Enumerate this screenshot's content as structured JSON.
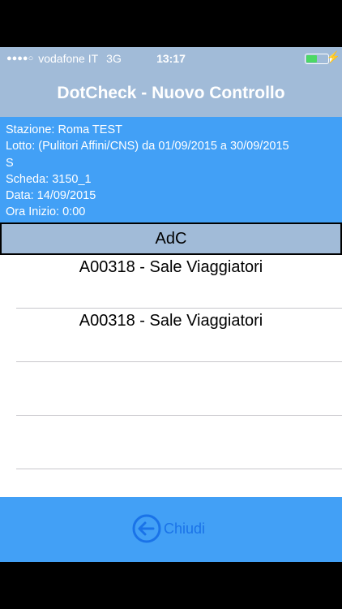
{
  "status_bar": {
    "signal_dots": "●●●●○",
    "carrier": "vodafone IT",
    "network": "3G",
    "time": "13:17",
    "charging_symbol": "⚡",
    "battery_level": 0.45,
    "battery_color": "#4cd964"
  },
  "nav": {
    "title": "DotCheck - Nuovo Controllo"
  },
  "info": {
    "stazione": "Stazione: Roma TEST",
    "lotto_line1": "Lotto: (Pulitori Affini/CNS) da 01/09/2015 a 30/09/2015",
    "lotto_line2": "S",
    "scheda": "Scheda: 3150_1",
    "data": "Data: 14/09/2015",
    "ora_inizio": "Ora Inizio: 0:00"
  },
  "section": {
    "header": "AdC"
  },
  "list": {
    "items": [
      {
        "label": "A00318 - Sale Viaggiatori"
      },
      {
        "label": "A00318 - Sale Viaggiatori"
      },
      {
        "label": ""
      },
      {
        "label": ""
      }
    ]
  },
  "footer": {
    "close_label": "Chiudi",
    "close_icon": "circle-left-arrow-icon"
  },
  "colors": {
    "header_bg": "#a1bbd8",
    "panel_bg": "#42a0f6",
    "button_fg": "#1a73e8"
  }
}
